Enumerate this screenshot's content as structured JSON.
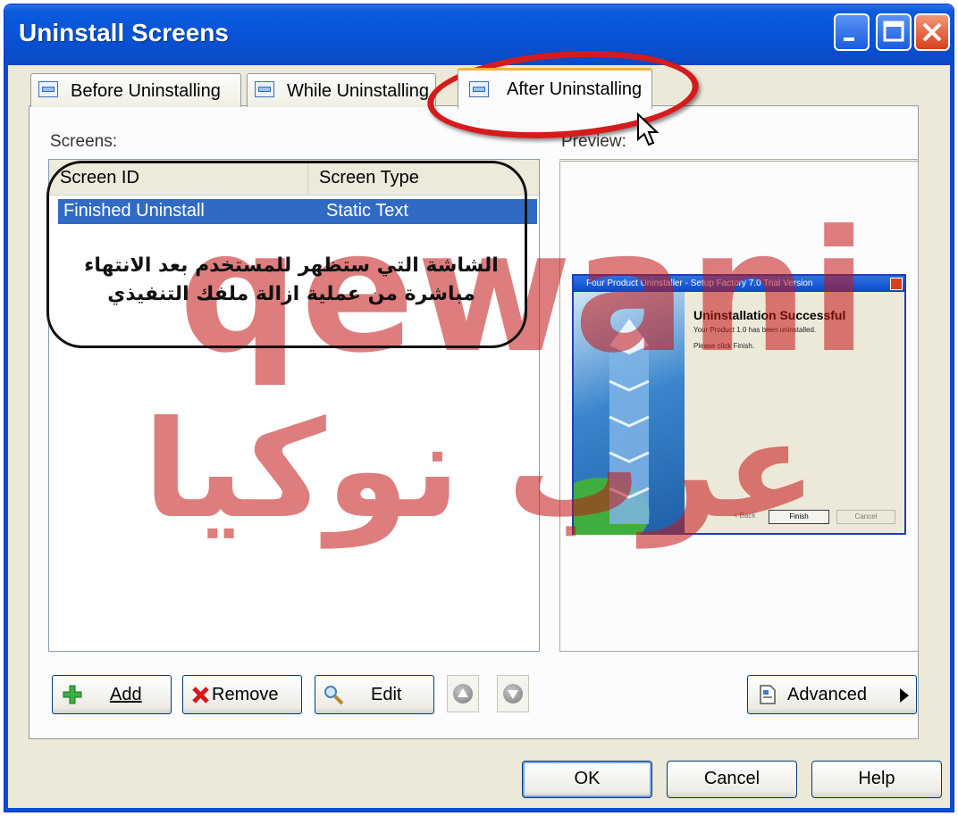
{
  "window": {
    "title": "Uninstall Screens"
  },
  "tabs": [
    {
      "label": "Before Uninstalling"
    },
    {
      "label": "While Uninstalling"
    },
    {
      "label": "After Uninstalling"
    }
  ],
  "screens": {
    "label": "Screens:",
    "columns": [
      "Screen ID",
      "Screen Type"
    ],
    "rows": [
      {
        "id": "Finished Uninstall",
        "type": "Static Text"
      }
    ]
  },
  "preview": {
    "label": "Preview:",
    "mini_title": "Four Product Uninstaller - Setup Factory 7.0 Trial Version",
    "heading": "Uninstallation Successful",
    "line1": "Your Product 1.0 has been uninstalled.",
    "line2": "Please click Finish.",
    "buttons": [
      "< Back",
      "Finish",
      "Cancel"
    ]
  },
  "actions": {
    "add": "Add",
    "remove": "Remove",
    "edit": "Edit",
    "advanced": "Advanced"
  },
  "dialog_buttons": {
    "ok": "OK",
    "cancel": "Cancel",
    "help": "Help"
  },
  "overlay": {
    "watermark_latin": "qewani",
    "watermark_arabic": "عرب نوكيا",
    "note_line1": "الشاشة التي ستظهر للمستخدم بعد الانتهاء",
    "note_line2": "مباشرة من عملية ازالة ملفك التنفيذي"
  },
  "colors": {
    "titlebar": "#0852d6",
    "selection": "#316ac5",
    "highlight_ring": "#d41c1c",
    "watermark": "#c41414"
  }
}
